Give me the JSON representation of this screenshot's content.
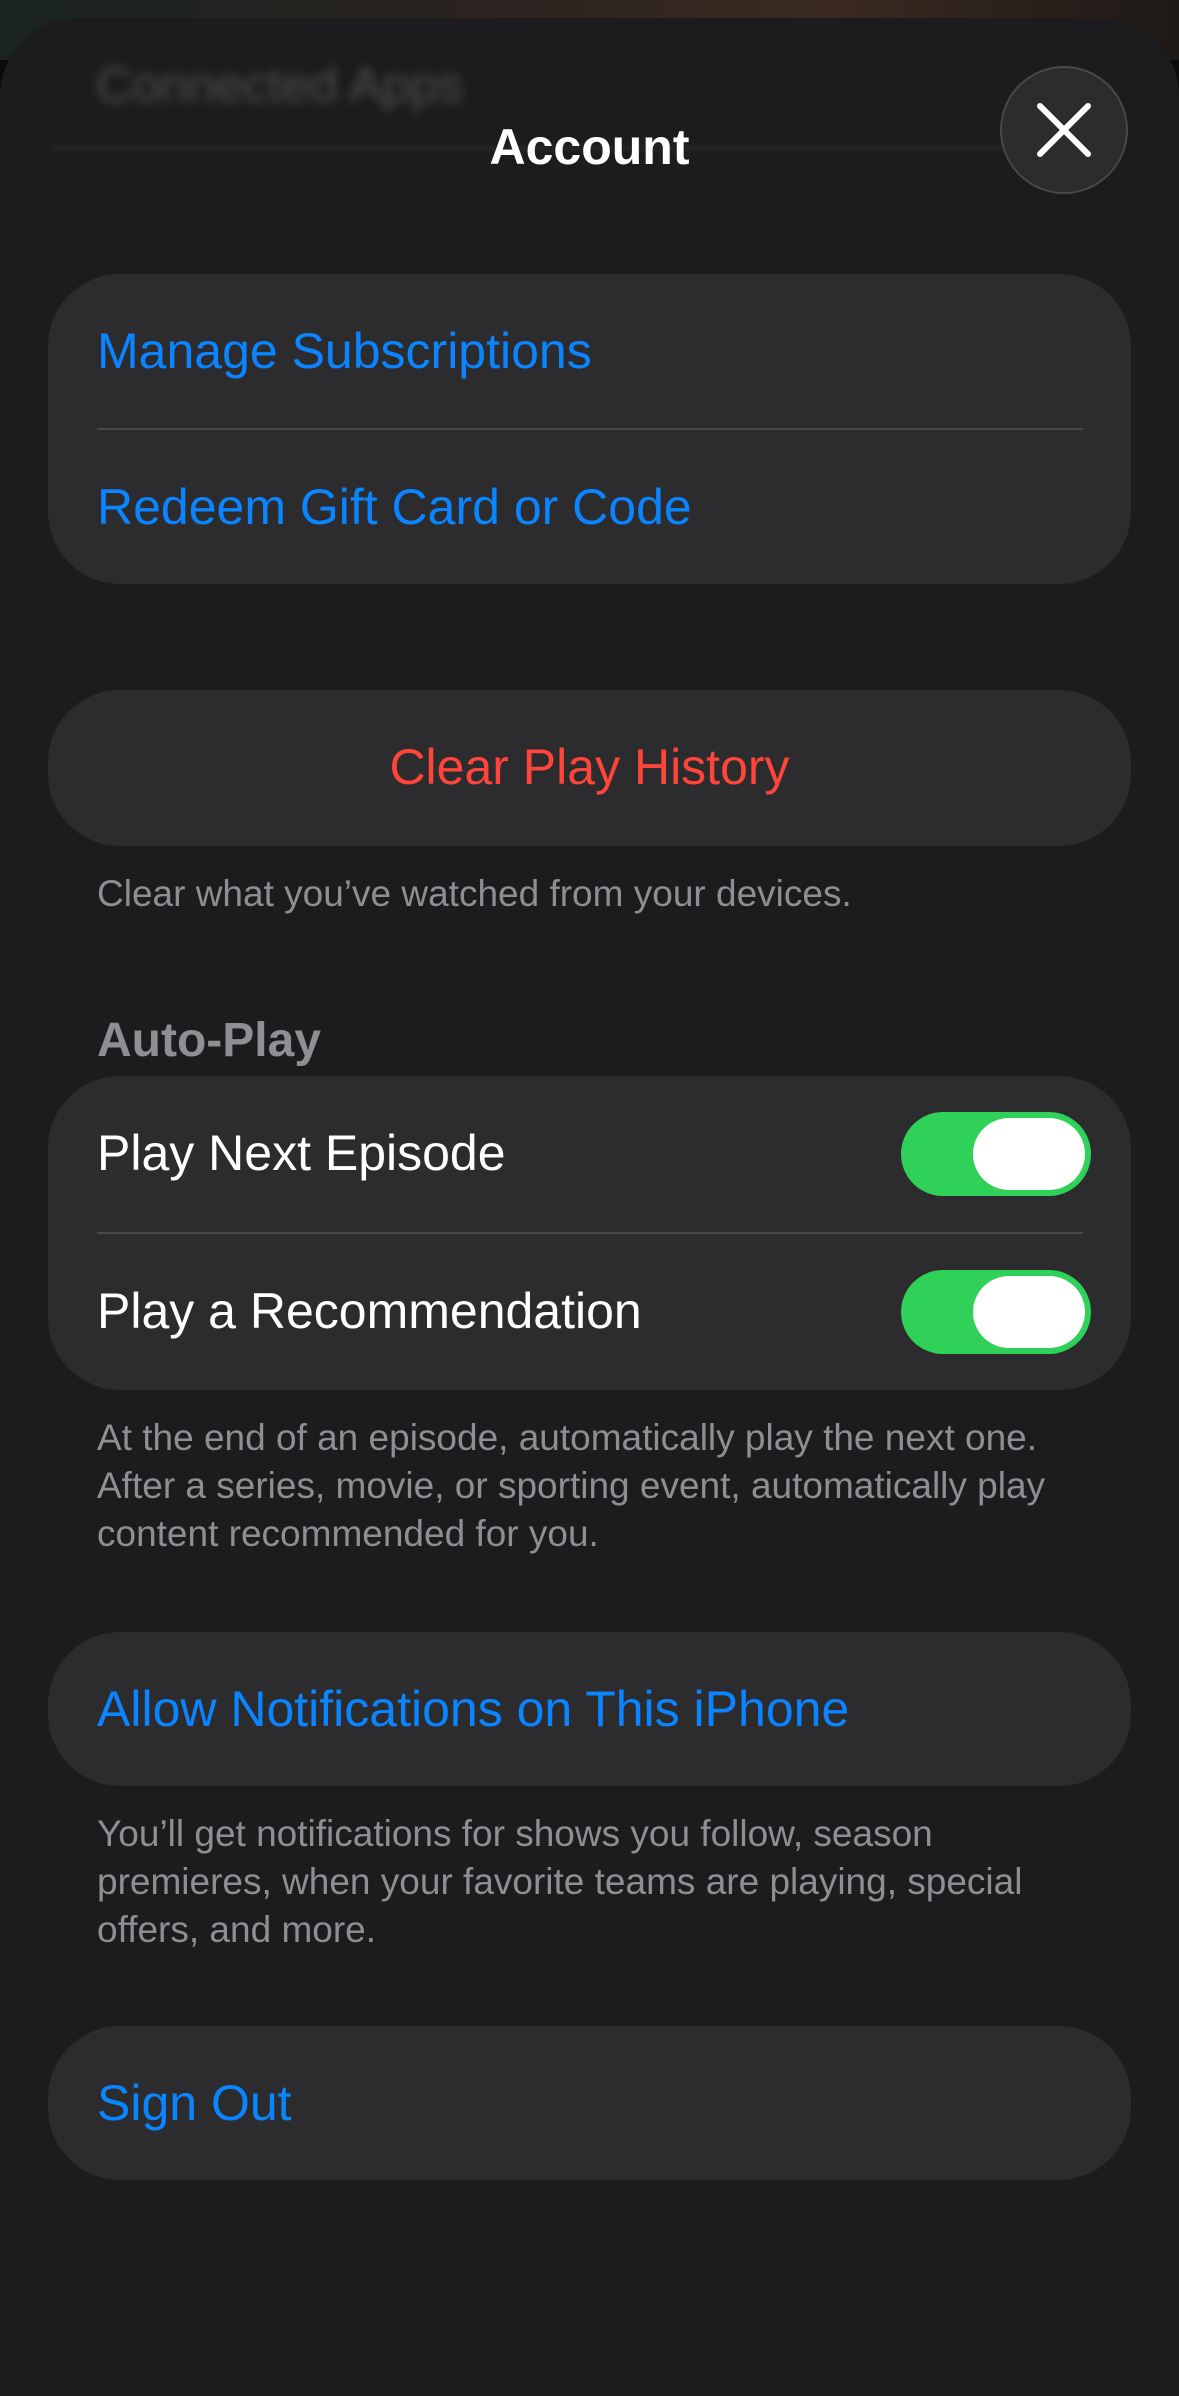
{
  "behind": {
    "ghost_title": "Connected Apps"
  },
  "header": {
    "title": "Account",
    "close_icon": "close-icon"
  },
  "account_group": {
    "manage_subscriptions": "Manage Subscriptions",
    "redeem": "Redeem Gift Card or Code"
  },
  "history": {
    "clear_label": "Clear Play History",
    "footnote": "Clear what you’ve watched from your devices."
  },
  "autoplay": {
    "header": "Auto-Play",
    "items": [
      {
        "label": "Play Next Episode",
        "on": true
      },
      {
        "label": "Play a Recommendation",
        "on": true
      }
    ],
    "footnote": "At the end of an episode, automatically play the next one. After a series, movie, or sporting event, automatically play content recommended for you."
  },
  "notifications": {
    "label": "Allow Notifications on This iPhone",
    "footnote": "You’ll get notifications for shows you follow, season premieres, when your favorite teams are playing, special offers, and more."
  },
  "sign_out": {
    "label": "Sign Out"
  },
  "colors": {
    "accent_blue": "#0a84ff",
    "destructive_red": "#ff453a",
    "toggle_green": "#30d158",
    "cell_bg": "#2c2c2e",
    "sheet_bg": "#1c1c1e"
  }
}
